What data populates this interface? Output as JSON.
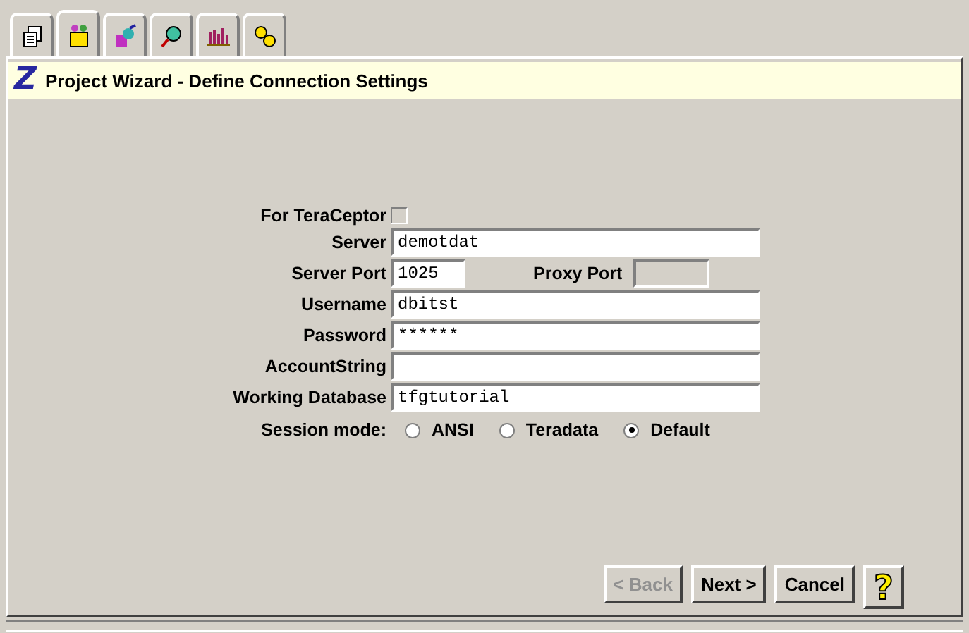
{
  "tabs": [
    {
      "kind": "documents",
      "selected": false
    },
    {
      "kind": "box",
      "selected": true
    },
    {
      "kind": "shapes",
      "selected": false
    },
    {
      "kind": "magnifier",
      "selected": false
    },
    {
      "kind": "chart",
      "selected": false
    },
    {
      "kind": "gears",
      "selected": false
    }
  ],
  "header": {
    "logo": "Z",
    "title": "Project Wizard - Define Connection Settings"
  },
  "form": {
    "teraceptor": {
      "label": "For TeraCeptor",
      "checked": false
    },
    "server": {
      "label": "Server",
      "value": "demotdat"
    },
    "server_port": {
      "label": "Server Port",
      "value": "1025"
    },
    "proxy_port": {
      "label": "Proxy Port",
      "disabled": true
    },
    "username": {
      "label": "Username",
      "value": "dbitst"
    },
    "password": {
      "label": "Password",
      "value": "******"
    },
    "account_string": {
      "label": "AccountString"
    },
    "working_database": {
      "label": "Working Database",
      "value": "tfgtutorial"
    },
    "session_mode": {
      "label": "Session mode:",
      "options": [
        {
          "label": "ANSI",
          "selected": false
        },
        {
          "label": "Teradata",
          "selected": false
        },
        {
          "label": "Default",
          "selected": true
        }
      ]
    }
  },
  "buttons": [
    {
      "label": "< Back",
      "disabled": true
    },
    {
      "label": "Next >",
      "disabled": false
    },
    {
      "label": "Cancel",
      "disabled": false
    },
    {
      "label": "?",
      "kind": "help",
      "disabled": false
    }
  ]
}
